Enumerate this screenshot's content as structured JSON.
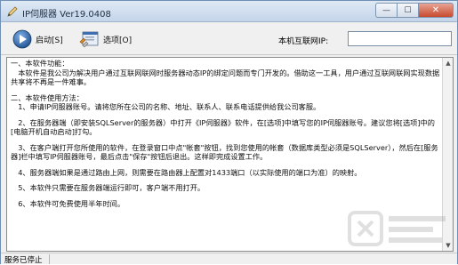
{
  "window": {
    "title": "IP伺服器 Ver19.0408",
    "minimize_glyph": "—",
    "maximize_glyph": "☐",
    "close_glyph": "✕"
  },
  "toolbar": {
    "start_label": "启动[S]",
    "options_label": "选项[O]",
    "ip_label": "本机互联网IP:",
    "ip_value": ""
  },
  "content": {
    "paragraphs": [
      "一、本软件功能：",
      "　本软件是我公司为解决用户通过互联网联网时服务器动态IP的绑定问题而专门开发的。借助这一工具，用户通过互联网联网实现数据共享将不再是一件难事。",
      "",
      "二、本软件使用方法：",
      "　1、申请IP伺服器账号。请将您所在公司的名称、地址、联系人、联系电话提供给我公司客服。",
      "",
      "　2、在服务器端（即安装SQLServer的服务器）中打开《IP伺服器》软件，在[选项]中填写您的IP伺服器账号。建议您将[选项]中的[电脑开机自动启动]打勾。",
      "",
      "　3、在客户端打开您所使用的软件，在登录窗口中点\"帐套\"按钮，找到您使用的帐套（数据库类型必须是SQLServer），然后在[服务器]栏中填写IP伺服器账号，最后点击\"保存\"按钮后退出。这样即完成设置工作。",
      "",
      "　4、服务器端如果是通过路由上网，则需要在路由器上配置对1433端口（以实际使用的端口为准）的映射。",
      "",
      "　5、本软件只需要在服务器端运行即可，客户端不用打开。",
      "",
      "　6、本软件可免费使用半年时间。"
    ]
  },
  "statusbar": {
    "status": "服务已停止"
  },
  "colors": {
    "accent": "#1f4f8f",
    "close_button": "#c64a2e",
    "titlebar": "#c4d5ea"
  },
  "icons": {
    "app": "pen-icon",
    "start": "play-icon",
    "options": "settings-window-icon"
  }
}
